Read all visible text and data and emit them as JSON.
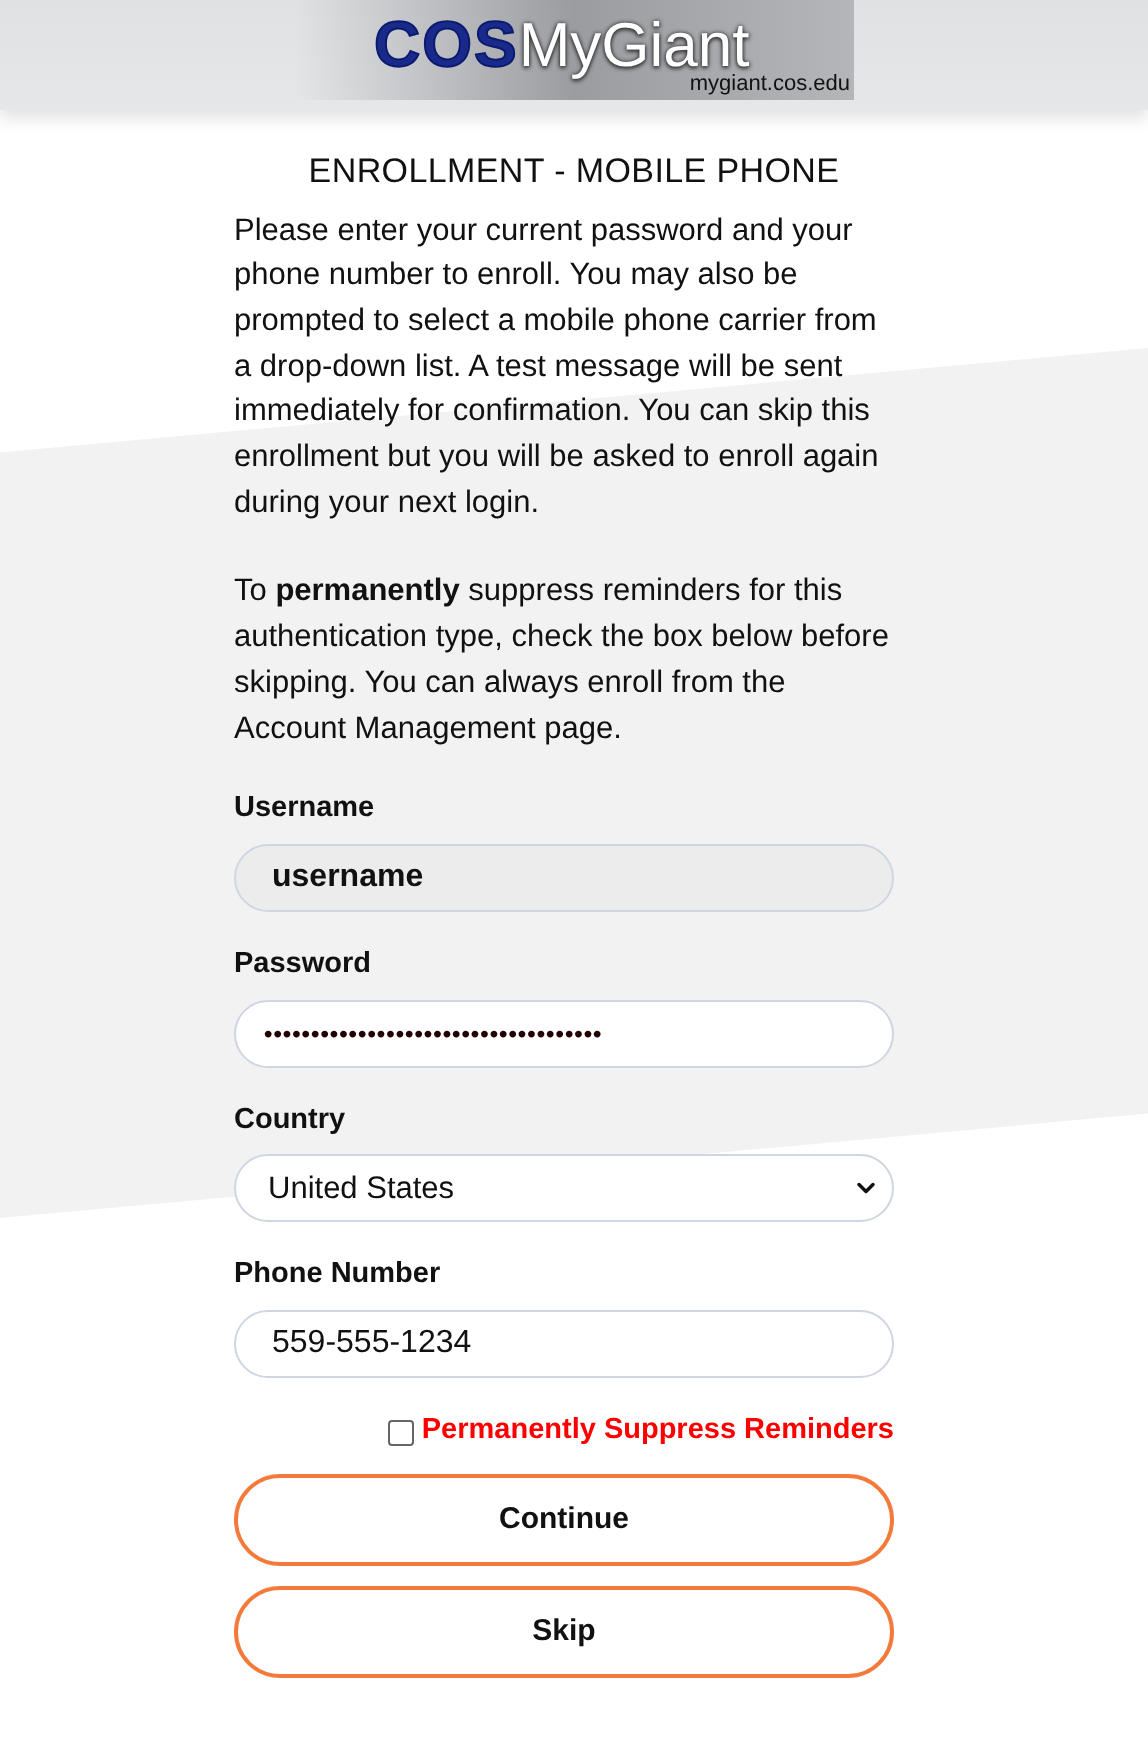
{
  "header": {
    "logo_bold": "COS",
    "logo_light": "MyGiant",
    "logo_url": "mygiant.cos.edu"
  },
  "title": "ENROLLMENT - MOBILE PHONE",
  "paragraphs": [
    "Please enter your current password and your phone number to enroll. You may also be prompted to select a mobile phone carrier from a drop-down list. A test message will be sent immediately for confirmation. You can skip this enrollment but you will be asked to enroll again during your next login.",
    "To **permanently** suppress reminders for this authentication type, check the box below before skipping. You can always enroll from the Account Management page."
  ],
  "fields": [
    {
      "kind": "readonly",
      "label": "Username",
      "value": "username"
    },
    {
      "kind": "password",
      "label": "Password",
      "value": "••••••••••••••••••••••••••••••••••••"
    },
    {
      "kind": "select",
      "label": "Country",
      "value": "United States"
    },
    {
      "kind": "text",
      "label": "Phone Number",
      "value": "559-555-1234"
    }
  ],
  "suppress": {
    "label": "Permanently Suppress Reminders",
    "checked": false
  },
  "buttons": [
    "Continue",
    "Skip"
  ]
}
